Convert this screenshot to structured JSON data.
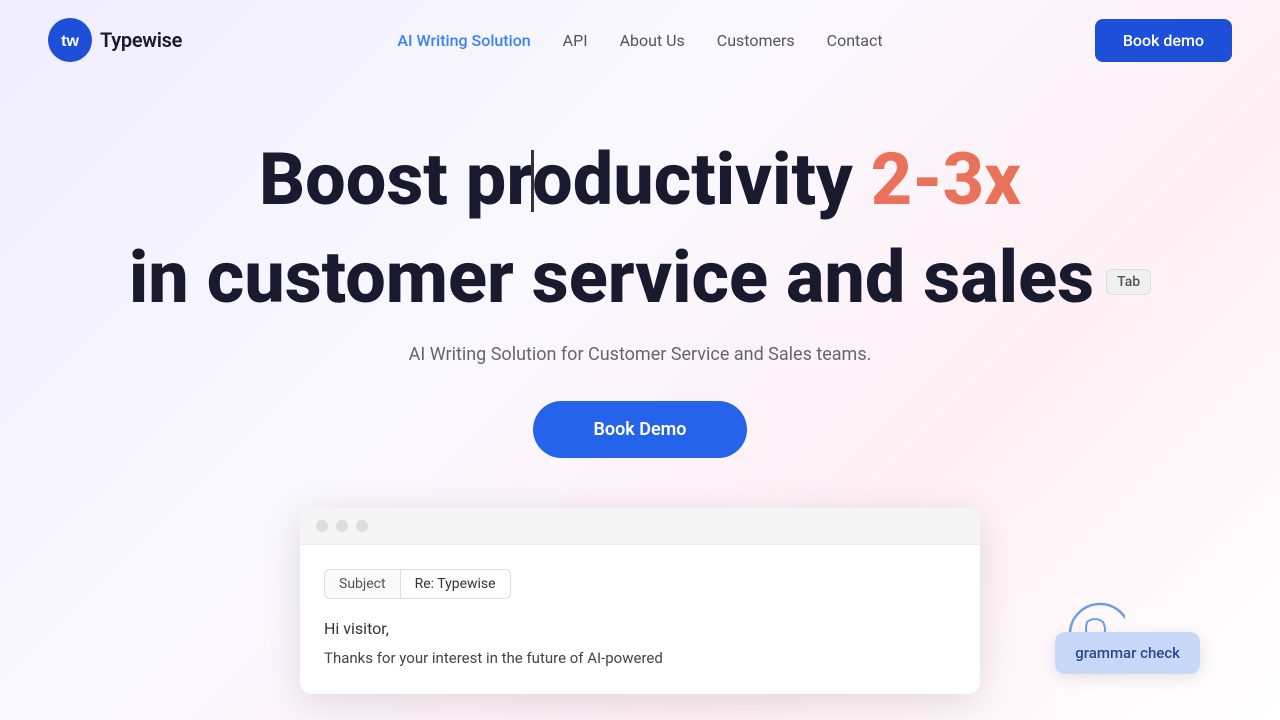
{
  "nav": {
    "logo_text": "Typewise",
    "links": [
      {
        "label": "AI Writing Solution",
        "active": true,
        "name": "ai-writing-solution"
      },
      {
        "label": "API",
        "active": false,
        "name": "api"
      },
      {
        "label": "About Us",
        "active": false,
        "name": "about-us"
      },
      {
        "label": "Customers",
        "active": false,
        "name": "customers"
      },
      {
        "label": "Contact",
        "active": false,
        "name": "contact"
      }
    ],
    "book_demo_label": "Book demo"
  },
  "hero": {
    "title_line1_start": "Boost pr",
    "title_line1_end": "oductivity ",
    "title_highlight": "2-3x",
    "title_line2": "in customer service and sales",
    "tab_badge": "Tab",
    "description": "AI Writing Solution for Customer Service and Sales teams.",
    "cta_label": "Book Demo"
  },
  "demo": {
    "subject_label": "Subject",
    "subject_value": "Re: Typewise",
    "greeting": "Hi visitor,",
    "body": "Thanks for your interest in the future of AI-powered"
  },
  "grammar_tooltip": {
    "text": "grammar check"
  }
}
